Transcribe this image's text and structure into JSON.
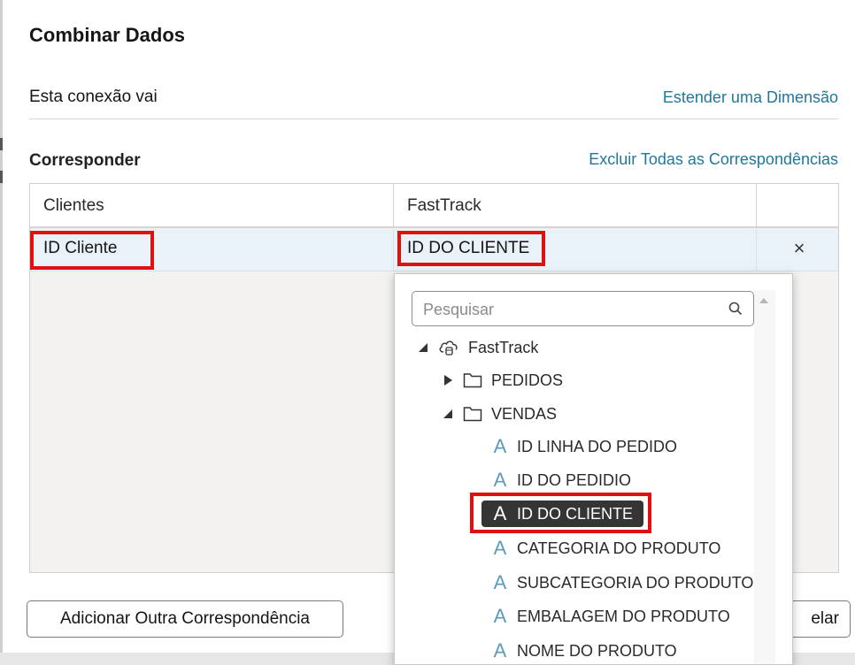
{
  "dialog": {
    "title": "Combinar Dados",
    "connection_text": "Esta conexão vai",
    "extend_link": "Estender uma Dimensão",
    "match_section": "Corresponder",
    "clear_link": "Excluir Todas as Correspondências",
    "add_button": "Adicionar Outra Correspondência",
    "cancel_button": "elar"
  },
  "grid": {
    "columns": [
      "Clientes",
      "FastTrack"
    ],
    "rows": [
      {
        "left": "ID Cliente",
        "right": "ID DO CLIENTE",
        "remove": "×"
      }
    ]
  },
  "popup": {
    "search_placeholder": "Pesquisar",
    "tree": [
      {
        "label": "FastTrack",
        "icon": "cloud-database-icon",
        "level": 0,
        "expanded": true
      },
      {
        "label": "PEDIDOS",
        "icon": "folder-icon",
        "level": 1,
        "expanded": false
      },
      {
        "label": "VENDAS",
        "icon": "folder-icon",
        "level": 1,
        "expanded": true
      },
      {
        "label": "ID LINHA DO PEDIDO",
        "icon": "attribute-icon",
        "level": 2
      },
      {
        "label": "ID DO PEDIDIO",
        "icon": "attribute-icon",
        "level": 2
      },
      {
        "label": "ID DO CLIENTE",
        "icon": "attribute-icon",
        "level": 2,
        "selected": true
      },
      {
        "label": "CATEGORIA DO PRODUTO",
        "icon": "attribute-icon",
        "level": 2
      },
      {
        "label": "SUBCATEGORIA DO PRODUTO",
        "icon": "attribute-icon",
        "level": 2
      },
      {
        "label": "EMBALAGEM DO PRODUTO",
        "icon": "attribute-icon",
        "level": 2
      },
      {
        "label": "NOME DO PRODUTO",
        "icon": "attribute-icon",
        "level": 2
      }
    ],
    "attribute_glyph": "A"
  },
  "colors": {
    "link": "#227799",
    "highlight": "#e01010",
    "row_selected": "#e8f2f8",
    "attribute_icon": "#5b9bbd",
    "selected_bg": "#353535"
  }
}
